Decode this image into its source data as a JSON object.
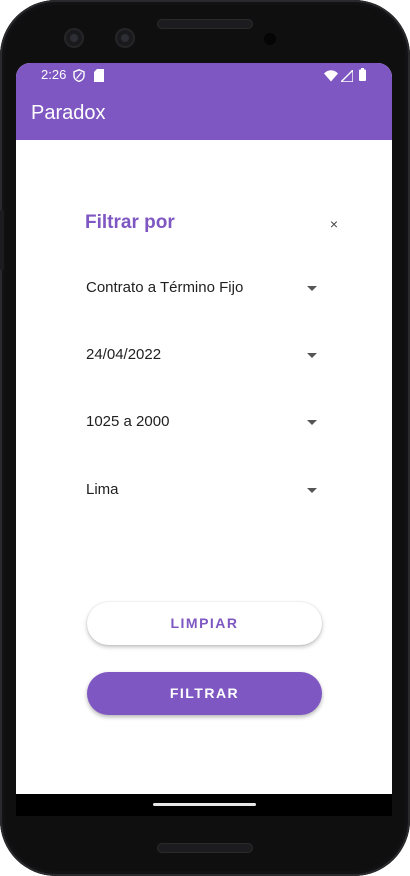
{
  "status_bar": {
    "time": "2:26",
    "icons": [
      "shield-icon",
      "sd-card-icon",
      "wifi-icon",
      "signal-icon",
      "battery-icon"
    ]
  },
  "app_bar": {
    "title": "Paradox",
    "color": "#7e57c2"
  },
  "filter": {
    "title": "Filtrar por",
    "close_label": "×",
    "dropdowns": [
      {
        "value": "Contrato a Término Fijo"
      },
      {
        "value": "24/04/2022"
      },
      {
        "value": "1025 a 2000"
      },
      {
        "value": "Lima"
      }
    ],
    "clear_label": "LIMPIAR",
    "filter_label": "FILTRAR"
  }
}
